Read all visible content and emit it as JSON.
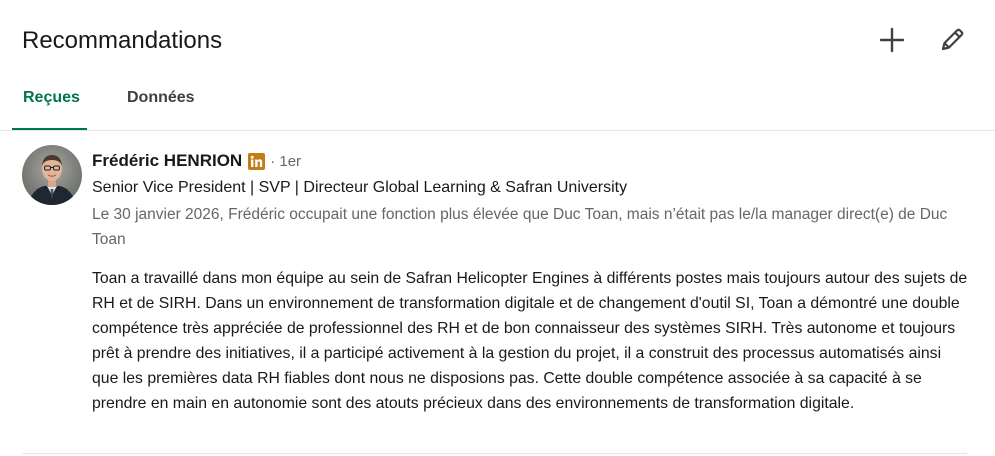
{
  "header": {
    "title": "Recommandations",
    "add_icon": "plus-icon",
    "edit_icon": "pencil-icon"
  },
  "tabs": [
    {
      "label": "Reçues",
      "active": true
    },
    {
      "label": "Données",
      "active": false
    }
  ],
  "recommendation": {
    "name": "Frédéric HENRION",
    "badge_icon": "linkedin-icon",
    "degree": "· 1er",
    "headline": "Senior Vice President | SVP | Directeur Global Learning & Safran University",
    "context": "Le 30 janvier 2026, Frédéric occupait une fonction plus élevée que Duc Toan, mais n’était pas le/la manager direct(e) de Duc Toan",
    "text": "Toan a travaillé dans mon équipe au sein de Safran Helicopter Engines à différents postes mais toujours autour des sujets de RH et de SIRH. Dans un environnement de transformation digitale et de changement d'outil SI, Toan a démontré une double compétence très appréciée de professionnel des RH et de bon connaisseur des systèmes SIRH. Très autonome et toujours prêt à prendre des initiatives, il a participé activement à la gestion du projet, il a construit des processus automatisés ainsi que les premières data RH fiables dont nous ne disposions pas. Cette double compétence associée à sa capacité à se prendre en main en autonomie sont des atouts précieux dans des environnements de transformation digitale."
  },
  "colors": {
    "accent": "#01754f",
    "badge": "#c37d16",
    "text": "#191919",
    "muted": "#666666"
  }
}
